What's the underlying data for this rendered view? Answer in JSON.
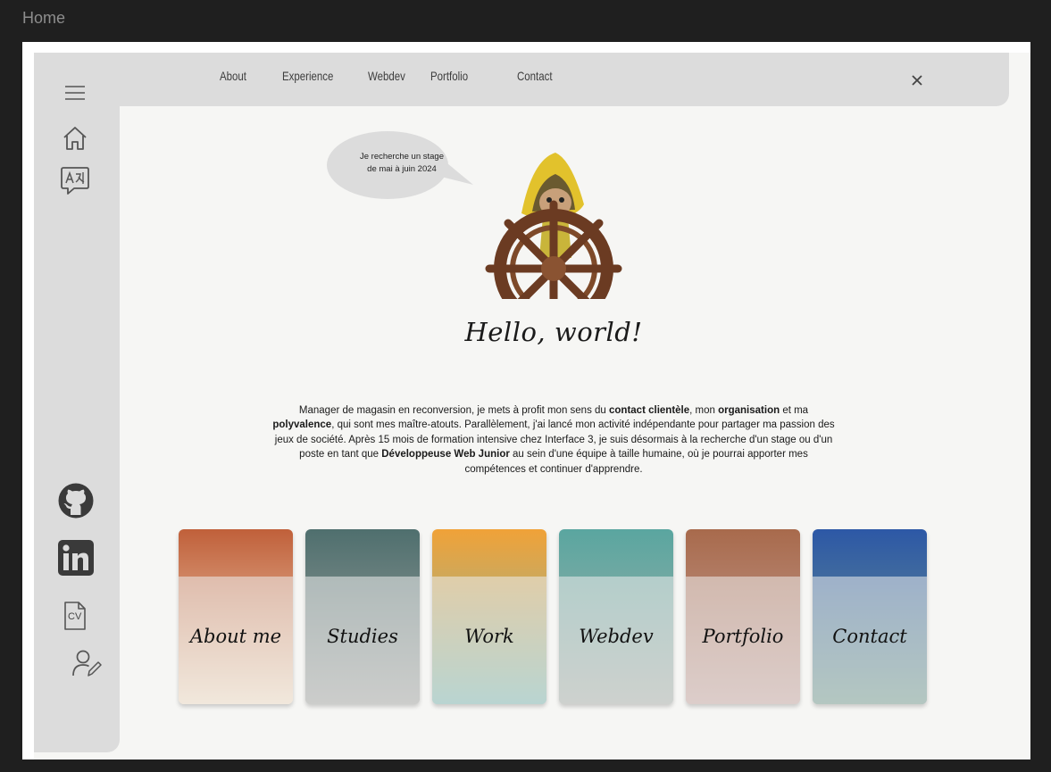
{
  "window": {
    "title": "Home"
  },
  "nav": {
    "links": [
      "About",
      "Experience",
      "Webdev",
      "Portfolio",
      "Contact"
    ],
    "close_icon": "close-icon"
  },
  "sidebar": {
    "top_icons": [
      "menu-icon",
      "home-icon",
      "translate-icon"
    ],
    "bottom_icons": [
      "github-icon",
      "linkedin-icon",
      "cv-icon",
      "user-edit-icon"
    ],
    "cv_label": "CV"
  },
  "hero": {
    "bubble_line1": "Je recherche un stage",
    "bubble_line2": "de mai à juin 2024",
    "greeting": "Hello, world!"
  },
  "intro": {
    "t1": "Manager de magasin en reconversion, je mets à profit mon sens du ",
    "b1": "contact clientèle",
    "t2": ", mon ",
    "b2": "organisation",
    "t3": " et ma ",
    "b3": "polyvalence",
    "t4": ", qui sont mes maître-atouts. Parallèlement, j'ai lancé mon activité indépendante pour partager ma passion des jeux de société. Après 15 mois de formation intensive chez Interface 3, je suis désormais à la recherche d'un stage ou d'un poste en tant que ",
    "b4": "Développeuse Web Junior",
    "t5": " au sein d'une équipe à taille humaine, où je pourrai apporter mes compétences et continuer d'apprendre."
  },
  "cards": [
    {
      "label": "About me",
      "top": "#c0603a",
      "bottom": "#f6e2c8"
    },
    {
      "label": "Studies",
      "top": "#4f6f6e",
      "bottom": "#a4a6a2"
    },
    {
      "label": "Work",
      "top": "#f0a238",
      "bottom": "#7ab7b0"
    },
    {
      "label": "Webdev",
      "top": "#5aa6a0",
      "bottom": "#a8b0a8"
    },
    {
      "label": "Portfolio",
      "top": "#a86a4c",
      "bottom": "#c8a7a0"
    },
    {
      "label": "Contact",
      "top": "#2d58a6",
      "bottom": "#6f998c"
    }
  ],
  "colors": {
    "background": "#1f1f1f",
    "page": "#f6f6f4",
    "bars": "#dcdcdc"
  }
}
